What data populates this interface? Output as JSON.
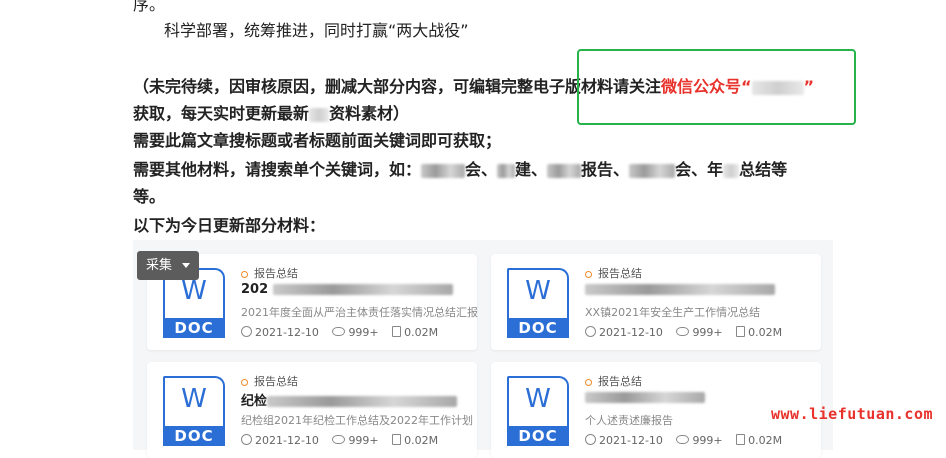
{
  "article": {
    "line_prev_tail": "序。",
    "line_1": "科学部署，统筹推进，同时打赢“两大战役”",
    "notice_prefix": "（未完待续，因审核原因，删减大部分内容，可编辑完整电子版材料请关注",
    "notice_highlight": "微信公众号“",
    "notice_highlight_end": "”",
    "notice_line2_a": "获取，每天实时更新最新",
    "notice_line2_b": "资料素材）",
    "line_search": "需要此篇文章搜标题或者标题前面关键词即可获取；",
    "line_other_a": "需要其他材料，请搜索单个关键词，如：",
    "line_other_b": "会、",
    "line_other_c": "建、",
    "line_other_d": "报告、",
    "line_other_e": "会、年",
    "line_other_f": "总结等",
    "line_other_tail": "等。",
    "line_today": "以下为今日更新部分材料："
  },
  "collect_button": {
    "label": "采集"
  },
  "cards": [
    {
      "icon_top": "W",
      "icon_band": "DOC",
      "tag": "报告总结",
      "title_prefix": "202",
      "subtitle": "2021年度全面从严治主体责任落实情况总结汇报",
      "date": "2021-12-10",
      "views": "999+",
      "size": "0.02M"
    },
    {
      "icon_top": "W",
      "icon_band": "DOC",
      "tag": "报告总结",
      "title_prefix": "",
      "subtitle": "XX镇2021年安全生产工作情况总结",
      "date": "2021-12-10",
      "views": "999+",
      "size": "0.02M"
    },
    {
      "icon_top": "W",
      "icon_band": "DOC",
      "tag": "报告总结",
      "title_prefix": "纪检",
      "subtitle": "纪检组2021年纪检工作总结及2022年工作计划",
      "date": "2021-12-10",
      "views": "999+",
      "size": "0.02M"
    },
    {
      "icon_top": "W",
      "icon_band": "DOC",
      "tag": "报告总结",
      "title_prefix": "",
      "subtitle": "个人述责述廉报告",
      "date": "2021-12-10",
      "views": "999+",
      "size": "0.02M"
    }
  ],
  "watermark": "www.liefutuan.com",
  "colors": {
    "accent_red": "#e8322b",
    "highlight_box": "#27b34a",
    "doc_blue": "#2b6fd6"
  },
  "icons": [
    "word-doc-icon",
    "tag-dot-icon",
    "clock-icon",
    "eye-icon",
    "file-icon",
    "caret-down-icon"
  ]
}
